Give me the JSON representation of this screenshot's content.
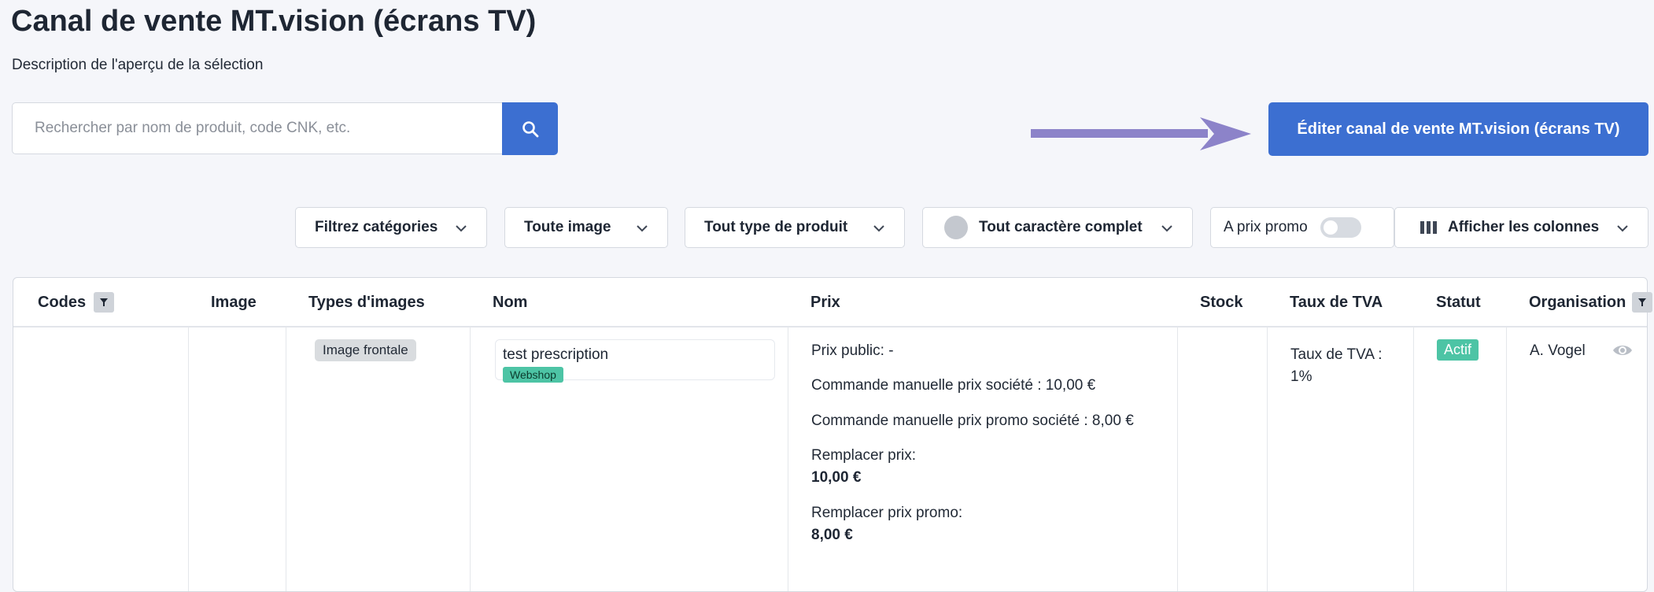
{
  "header": {
    "title": "Canal de vente MT.vision (écrans TV)",
    "subtitle": "Description de l'aperçu de la sélection"
  },
  "search": {
    "placeholder": "Rechercher par nom de produit, code CNK, etc.",
    "value": ""
  },
  "actions": {
    "edit_label": "Éditer canal de vente MT.vision (écrans TV)"
  },
  "filters": {
    "categories": "Filtrez catégories",
    "image": "Toute image",
    "product_type": "Tout type de produit",
    "completeness": "Tout caractère complet",
    "promo": "A prix promo",
    "columns": "Afficher les colonnes"
  },
  "table": {
    "columns": [
      "Codes",
      "Image",
      "Types d'images",
      "Nom",
      "Prix",
      "Stock",
      "Taux de TVA",
      "Statut",
      "Organisation"
    ],
    "rows": [
      {
        "image_type": "Image frontale",
        "name": "test prescription",
        "channel": "Webshop",
        "price_public": "Prix public: -",
        "price_manual": "Commande manuelle prix société : 10,00 €",
        "price_manual_promo": "Commande manuelle prix promo société : 8,00 €",
        "override_label": "Remplacer prix:",
        "override_value": "10,00 €",
        "override_promo_label": "Remplacer prix promo:",
        "override_promo_value": "8,00 €",
        "tva_label": "Taux de TVA :",
        "tva_value": "1%",
        "status": "Actif",
        "organisation": "A. Vogel"
      }
    ]
  },
  "colors": {
    "primary": "#3c6fd1",
    "arrow": "#8c83c9",
    "success": "#4dc4a5",
    "background": "#f5f6fa"
  }
}
